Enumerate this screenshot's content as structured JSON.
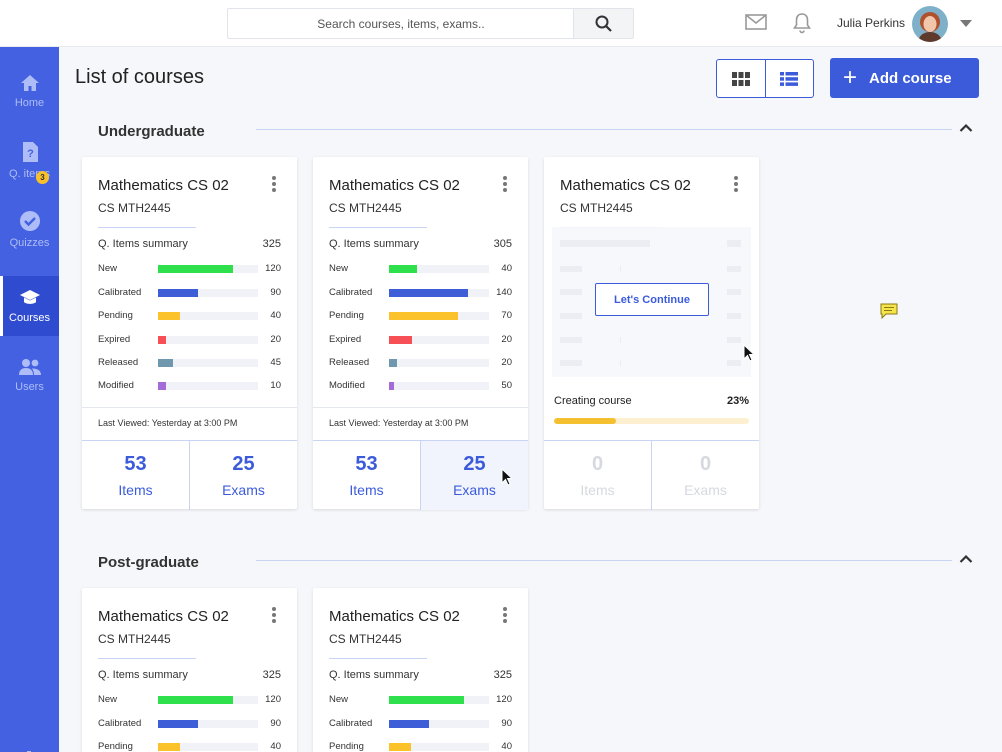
{
  "search": {
    "placeholder": "Search courses, items, exams.."
  },
  "user": {
    "name": "Julia Perkins"
  },
  "sidebar": {
    "items": [
      {
        "label": "Home",
        "icon": "home-icon"
      },
      {
        "label": "Q. items",
        "icon": "question-doc-icon"
      },
      {
        "label": "Quizzes",
        "icon": "check-circle-icon",
        "badge": "3"
      },
      {
        "label": "Courses",
        "icon": "graduation-cap-icon",
        "active": true
      },
      {
        "label": "Users",
        "icon": "users-icon"
      }
    ]
  },
  "header": {
    "title": "List of courses",
    "add_label": "Add course"
  },
  "colors": {
    "accent": "#3b5bdb",
    "sidebar": "#4361e0",
    "new": "#2ee04c",
    "calibrated": "#3d5ed6",
    "pending": "#fcc22b",
    "expired": "#f64f55",
    "released": "#6f97ad",
    "modified": "#a46cd8"
  },
  "sections": [
    {
      "title": "Undergraduate",
      "cards": [
        {
          "title": "Mathematics CS 02",
          "code": "CS MTH2445",
          "summary_label": "Q. Items summary",
          "total": "325",
          "stats": [
            {
              "label": "New",
              "value": "120",
              "pct": 0.75
            },
            {
              "label": "Calibrated",
              "value": "90",
              "pct": 0.4
            },
            {
              "label": "Pending",
              "value": "40",
              "pct": 0.22
            },
            {
              "label": "Expired",
              "value": "20",
              "pct": 0.08
            },
            {
              "label": "Released",
              "value": "45",
              "pct": 0.15
            },
            {
              "label": "Modified",
              "value": "10",
              "pct": 0.08
            }
          ],
          "last_viewed": "Last Viewed: Yesterday at 3:00 PM",
          "items": "53",
          "items_label": "Items",
          "exams": "25",
          "exams_label": "Exams"
        },
        {
          "title": "Mathematics CS 02",
          "code": "CS MTH2445",
          "summary_label": "Q. Items summary",
          "total": "305",
          "stats": [
            {
              "label": "New",
              "value": "40",
              "pct": 0.28
            },
            {
              "label": "Calibrated",
              "value": "140",
              "pct": 0.79
            },
            {
              "label": "Pending",
              "value": "70",
              "pct": 0.69
            },
            {
              "label": "Expired",
              "value": "20",
              "pct": 0.23
            },
            {
              "label": "Released",
              "value": "20",
              "pct": 0.08
            },
            {
              "label": "Modified",
              "value": "50",
              "pct": 0.05
            }
          ],
          "last_viewed": "Last Viewed: Yesterday at 3:00 PM",
          "items": "53",
          "items_label": "Items",
          "exams": "25",
          "exams_label": "Exams"
        },
        {
          "title": "Mathematics CS 02",
          "code": "CS MTH2445",
          "continue_label": "Let's Continue",
          "creating_label": "Creating course",
          "progress_pct": "23%",
          "progress": 0.32,
          "items": "0",
          "items_label": "Items",
          "exams": "0",
          "exams_label": "Exams"
        }
      ]
    },
    {
      "title": "Post-graduate",
      "cards": [
        {
          "title": "Mathematics CS 02",
          "code": "CS MTH2445",
          "summary_label": "Q. Items summary",
          "total": "325",
          "stats": [
            {
              "label": "New",
              "value": "120",
              "pct": 0.75
            },
            {
              "label": "Calibrated",
              "value": "90",
              "pct": 0.4
            },
            {
              "label": "Pending",
              "value": "40",
              "pct": 0.22
            }
          ]
        },
        {
          "title": "Mathematics CS 02",
          "code": "CS MTH2445",
          "summary_label": "Q. Items summary",
          "total": "325",
          "stats": [
            {
              "label": "New",
              "value": "120",
              "pct": 0.75
            },
            {
              "label": "Calibrated",
              "value": "90",
              "pct": 0.4
            },
            {
              "label": "Pending",
              "value": "40",
              "pct": 0.22
            }
          ]
        }
      ]
    }
  ]
}
